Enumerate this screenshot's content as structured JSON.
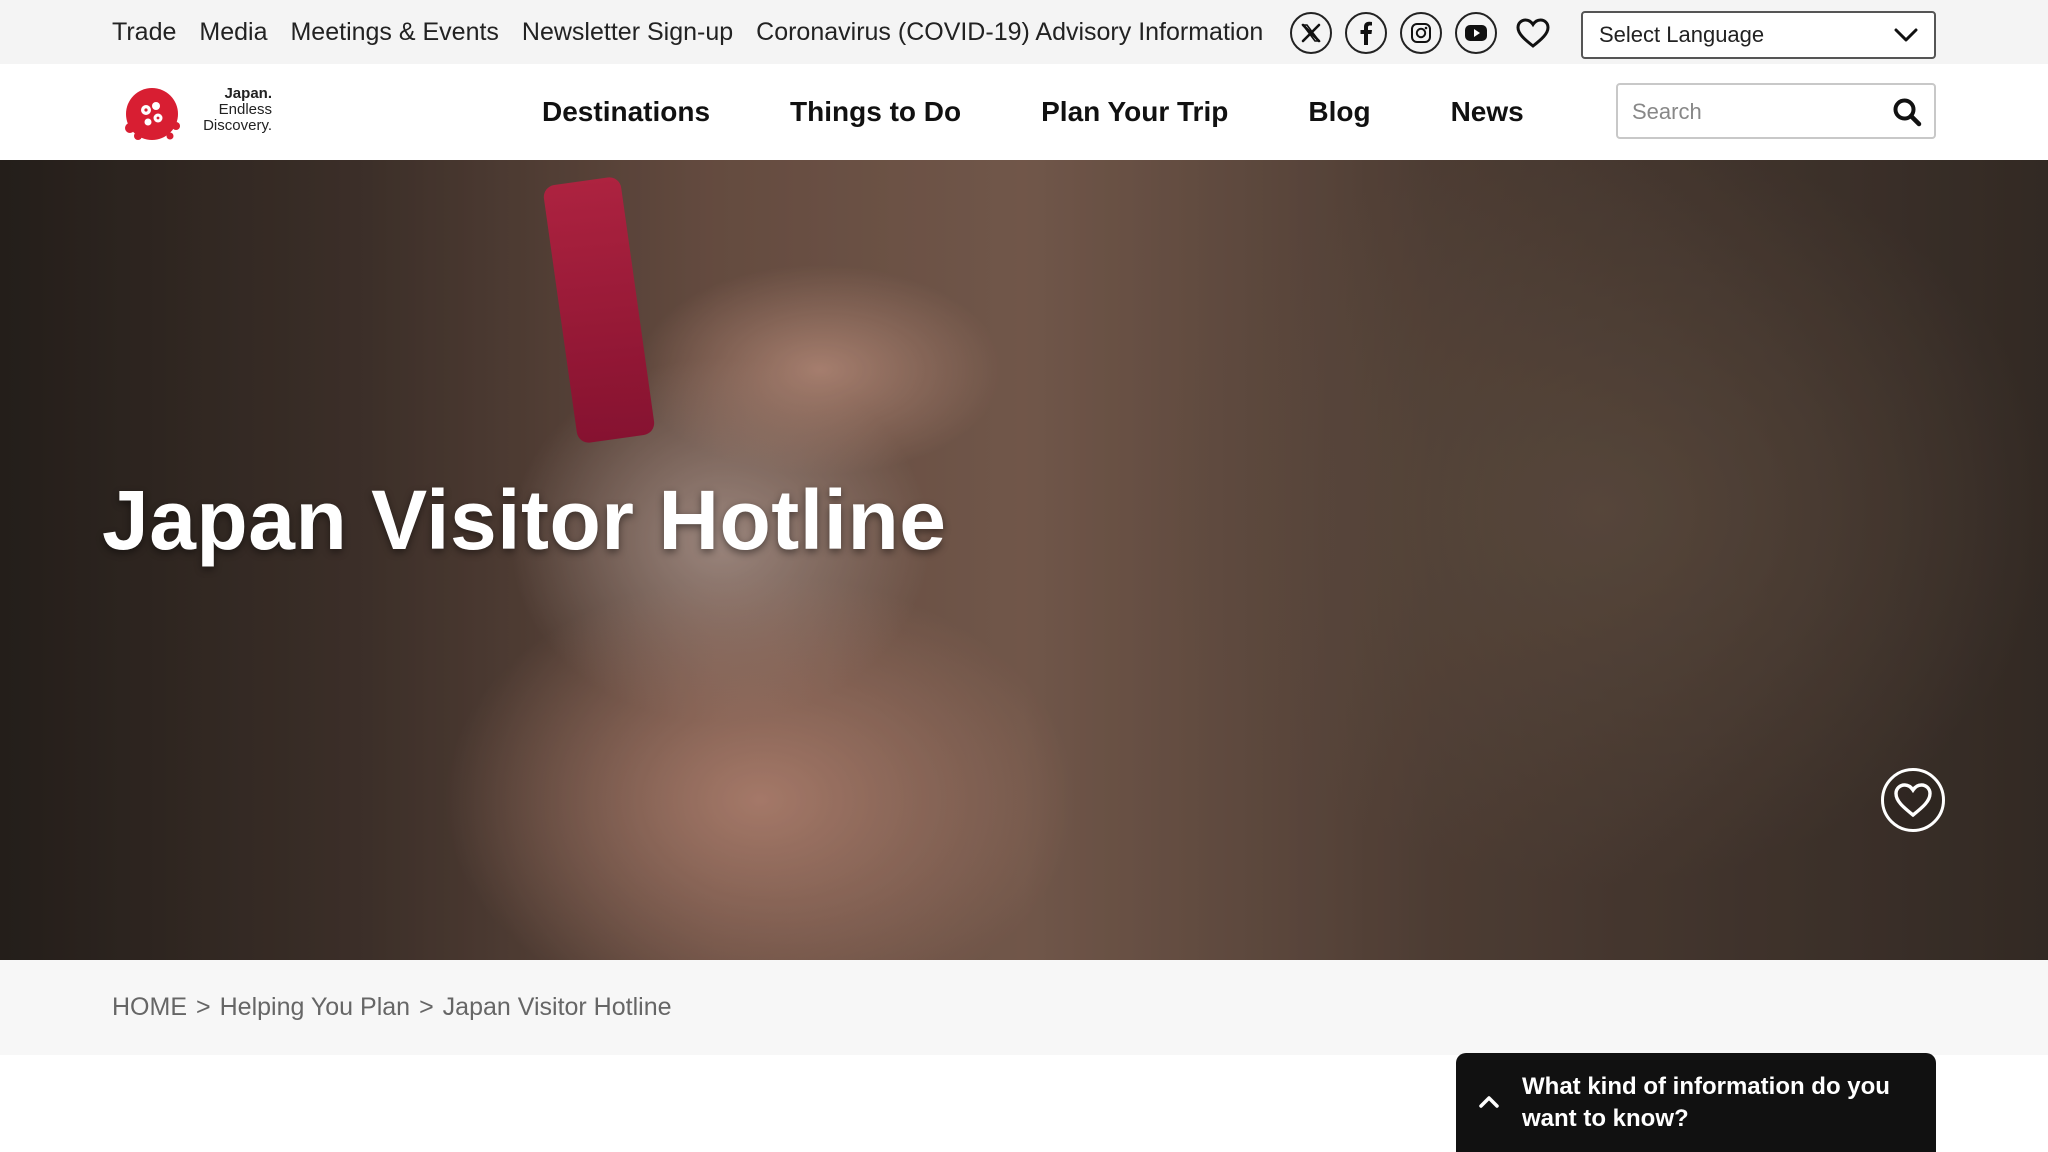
{
  "topbar": {
    "links": [
      "Trade",
      "Media",
      "Meetings & Events",
      "Newsletter Sign-up",
      "Coronavirus (COVID-19) Advisory Information"
    ],
    "socials": [
      "x-icon",
      "facebook-icon",
      "instagram-icon",
      "youtube-icon"
    ],
    "language": "Select Language"
  },
  "header": {
    "logo": {
      "line1": "Japan.",
      "line2": "Endless",
      "line3": "Discovery."
    },
    "nav": [
      "Destinations",
      "Things to Do",
      "Plan Your Trip",
      "Blog",
      "News"
    ],
    "search_placeholder": "Search"
  },
  "hero": {
    "title": "Japan Visitor Hotline"
  },
  "breadcrumb": {
    "items": [
      "HOME",
      "Helping You Plan",
      "Japan Visitor Hotline"
    ],
    "separator": ">"
  },
  "help_widget": {
    "text": "What kind of information do you want to know?"
  },
  "colors": {
    "brand_red": "#d81e32",
    "topbar_bg": "#f4f4f4",
    "widget_bg": "#111111"
  }
}
